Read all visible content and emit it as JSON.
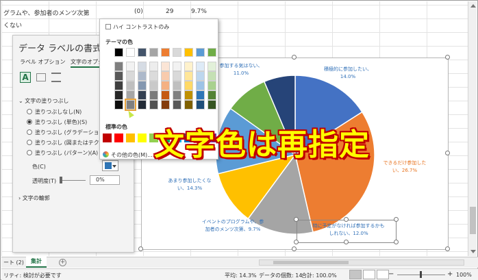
{
  "sheet": {
    "row1": {
      "label": "グラムや、参加者のメンツ次第",
      "value1": "(0)",
      "value2": "29",
      "value3": "9.7%"
    },
    "row2": {
      "label": "くない"
    }
  },
  "format_pane": {
    "title": "データ ラベルの書式...",
    "tab_label_options": "ラベル オプション",
    "tab_text_options": "文字のオプシ",
    "section_fill": "文字の塗りつぶし",
    "fill_options": [
      "塗りつぶしなし(N)",
      "塗りつぶし (単色)(S)",
      "塗りつぶし (グラデーション)(G)",
      "塗りつぶし (図またはテクスチャ)(P)",
      "塗りつぶし (パターン)(A)"
    ],
    "color_label": "色(C)",
    "transparency_label": "透明度(T)",
    "transparency_value": "0%",
    "section_outline": "文字の輪郭"
  },
  "color_dropdown": {
    "high_contrast_label": "ハイ コントラストのみ",
    "theme_colors_heading": "テーマの色",
    "standard_colors_heading": "標準の色",
    "more_colors_label": "その他の色(M)...",
    "theme_colors": [
      "#000000",
      "#ffffff",
      "#44546a",
      "#a5a5a5",
      "#ed7d31",
      "#d9d9d9",
      "#ffc000",
      "#5b9bd5",
      "#70ad47"
    ],
    "theme_shades": [
      [
        "#7f7f7f",
        "#f2f2f2",
        "#d6dce4",
        "#ededed",
        "#fbe5d6",
        "#f2f2f2",
        "#fff2cc",
        "#deebf7",
        "#e2f0d9"
      ],
      [
        "#595959",
        "#d9d9d9",
        "#adb9ca",
        "#dbdbdb",
        "#f8cbad",
        "#d9d9d9",
        "#ffe699",
        "#bdd7ee",
        "#c5e0b4"
      ],
      [
        "#404040",
        "#bfbfbf",
        "#8497b0",
        "#c9c9c9",
        "#f4b183",
        "#bfbfbf",
        "#ffd966",
        "#9dc3e6",
        "#a9d18e"
      ],
      [
        "#262626",
        "#a6a6a6",
        "#333f50",
        "#7b7b7b",
        "#c55a11",
        "#808080",
        "#bf9000",
        "#2e75b6",
        "#548235"
      ],
      [
        "#0d0d0d",
        "#808080",
        "#222a35",
        "#525252",
        "#843c0c",
        "#595959",
        "#7f6000",
        "#1f4e79",
        "#375623"
      ]
    ],
    "standard_colors": [
      "#c00000",
      "#ff0000",
      "#ffc000",
      "#ffff00",
      "#92d050",
      "#00b050",
      "#00b0f0",
      "#0070c0",
      "#002060",
      "#7030a0"
    ]
  },
  "chart_data": {
    "type": "pie",
    "categories": [
      "積極的に参加したい、",
      "できるだけ参加したい、",
      "特に予定がなければ参加するかもしれない、",
      "イベントのプログラムや、参加者のメンツ次第、",
      "あまり参加したくない、",
      "参加する気はない、"
    ],
    "values": [
      14.0,
      26.7,
      12.0,
      9.7,
      14.3,
      11.0
    ],
    "colors": [
      "#4472c4",
      "#ed7d31",
      "#a5a5a5",
      "#ffc000",
      "#5b9bd5",
      "#70ad47",
      "#264478"
    ],
    "labels": [
      {
        "lines": [
          "積極的に参加したい、",
          "14.0%"
        ],
        "color": "#2f6fb7"
      },
      {
        "lines": [
          "できるだけ参加した",
          "い、26.7%"
        ],
        "color": "#e8731f"
      },
      {
        "lines": [
          "特に予定がなければ参加するかも",
          "しれない、12.0%"
        ],
        "color": "#2f6fb7"
      },
      {
        "lines": [
          "イベントのプログラムや、参",
          "加者のメンツ次第、9.7%"
        ],
        "color": "#2f6fb7"
      },
      {
        "lines": [
          "あまり参加したくな",
          "い、14.3%"
        ],
        "color": "#2f6fb7"
      },
      {
        "lines": [
          "参加する気はない、",
          "11.0%"
        ],
        "color": "#2f6fb7"
      }
    ]
  },
  "overlay": {
    "caption": "文字色は再指定"
  },
  "tabs": {
    "sheet_prev": "ート (2)",
    "sheet_active": "集計",
    "add": "+"
  },
  "status": {
    "accessibility": "リティ: 検討が必要です",
    "average": "平均: 14.3%",
    "count": "データの個数: 14",
    "sum": "合計: 100.0%",
    "zoom": "100%"
  }
}
